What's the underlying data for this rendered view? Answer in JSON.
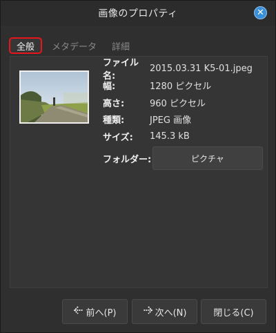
{
  "window": {
    "title": "画像のプロパティ",
    "close_glyph": "✕"
  },
  "tabs": [
    {
      "label": "全般",
      "active": true
    },
    {
      "label": "メタデータ",
      "active": false
    },
    {
      "label": "詳細",
      "active": false
    }
  ],
  "properties": {
    "filename_label": "ファイル名:",
    "filename_value": "2015.03.31 K5-01.jpeg",
    "width_label": "幅:",
    "width_value": "1280 ピクセル",
    "height_label": "高さ:",
    "height_value": "960 ピクセル",
    "type_label": "種類:",
    "type_value": "JPEG 画像",
    "size_label": "サイズ:",
    "size_value": "145.3 kB",
    "folder_label": "フォルダー:",
    "folder_value": "ピクチャ"
  },
  "footer": {
    "prev_label": "前へ(P)",
    "next_label": "次へ(N)",
    "close_label": "閉じる(C)"
  },
  "colors": {
    "accent": "#3a8fd9",
    "tab_highlight": "#e8161a",
    "background": "#2f2f2f"
  },
  "icons": {
    "close": "close-icon",
    "prev": "arrow-left-icon",
    "next": "arrow-right-icon"
  }
}
